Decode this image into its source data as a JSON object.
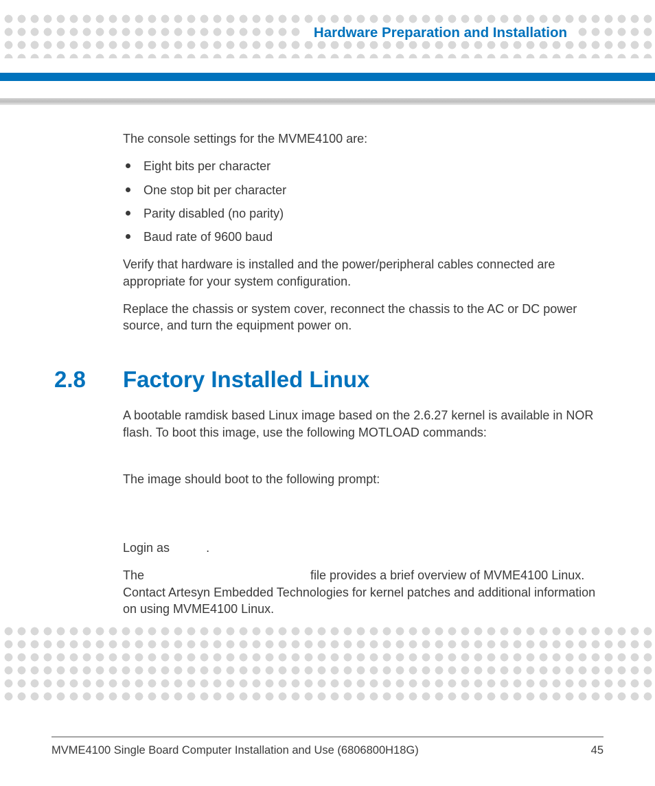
{
  "header": {
    "running_title": "Hardware Preparation and Installation"
  },
  "body": {
    "intro": "The console settings for the MVME4100 are:",
    "bullets": [
      "Eight bits per character",
      "One stop bit per character",
      "Parity disabled (no parity)",
      "Baud rate of 9600 baud"
    ],
    "p_verify": "Verify that hardware is installed and the power/peripheral cables connected are appropriate for your system configuration.",
    "p_replace": "Replace the chassis or system cover, reconnect the chassis to the AC or DC power source, and turn the equipment power on.",
    "section": {
      "number": "2.8",
      "title": "Factory Installed Linux"
    },
    "p_boot": "A bootable ramdisk based Linux image based on the 2.6.27 kernel is available in NOR flash. To boot this image, use the following MOTLOAD commands:",
    "p_prompt": "The image should boot to the following prompt:",
    "p_login_pre": "Login as ",
    "p_login_post": ".",
    "p_readme_pre": "The ",
    "p_readme_mid": " file provides a brief overview of MVME4100 Linux. Contact Artesyn Embedded Technologies for kernel patches and additional information on using MVME4100 Linux."
  },
  "footer": {
    "doc": "MVME4100 Single Board Computer Installation and Use (6806800H18G)",
    "page": "45"
  }
}
